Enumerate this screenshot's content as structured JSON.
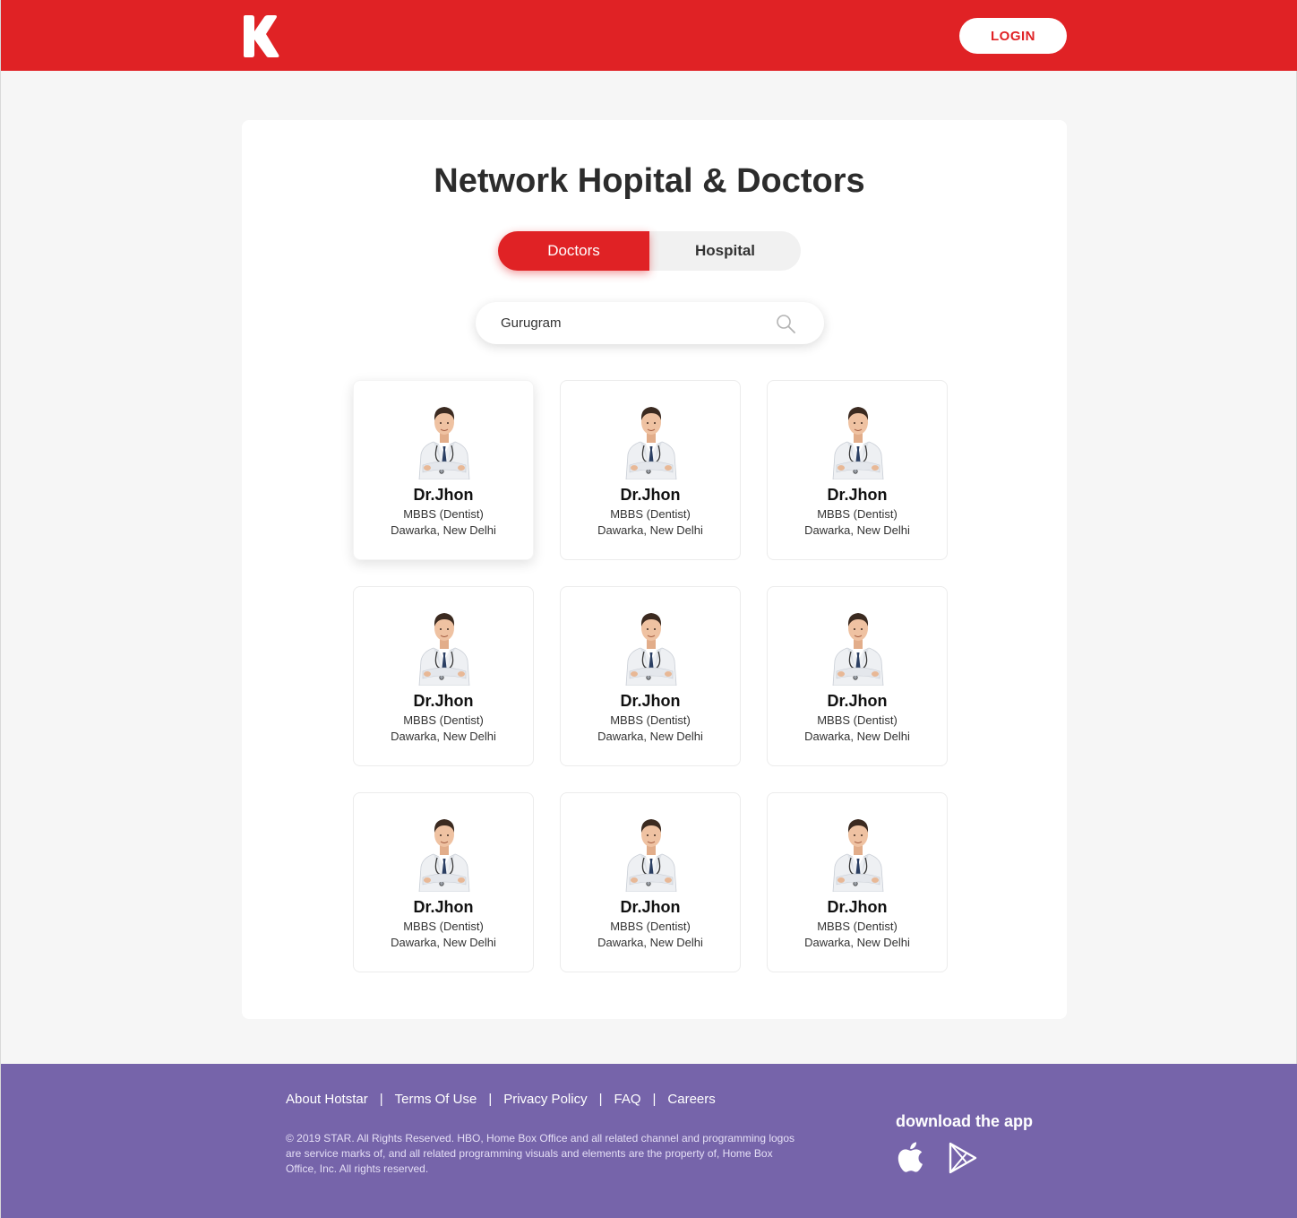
{
  "header": {
    "logo_letter": "K",
    "login_label": "LOGIN",
    "brand_color": "#e02225"
  },
  "main": {
    "title": "Network Hopital & Doctors",
    "tabs": [
      {
        "label": "Doctors",
        "active": true
      },
      {
        "label": "Hospital",
        "active": false
      }
    ],
    "search": {
      "value": "Gurugram",
      "icon": "search-icon"
    },
    "doctors": [
      {
        "name": "Dr.Jhon",
        "degree": "MBBS (Dentist)",
        "location": "Dawarka, New Delhi"
      },
      {
        "name": "Dr.Jhon",
        "degree": "MBBS (Dentist)",
        "location": "Dawarka, New Delhi"
      },
      {
        "name": "Dr.Jhon",
        "degree": "MBBS (Dentist)",
        "location": "Dawarka, New Delhi"
      },
      {
        "name": "Dr.Jhon",
        "degree": "MBBS (Dentist)",
        "location": "Dawarka, New Delhi"
      },
      {
        "name": "Dr.Jhon",
        "degree": "MBBS (Dentist)",
        "location": "Dawarka, New Delhi"
      },
      {
        "name": "Dr.Jhon",
        "degree": "MBBS (Dentist)",
        "location": "Dawarka, New Delhi"
      },
      {
        "name": "Dr.Jhon",
        "degree": "MBBS (Dentist)",
        "location": "Dawarka, New Delhi"
      },
      {
        "name": "Dr.Jhon",
        "degree": "MBBS (Dentist)",
        "location": "Dawarka, New Delhi"
      },
      {
        "name": "Dr.Jhon",
        "degree": "MBBS (Dentist)",
        "location": "Dawarka, New Delhi"
      }
    ]
  },
  "footer": {
    "links": [
      "About Hotstar",
      "Terms Of Use",
      "Privacy Policy",
      "FAQ",
      "Careers"
    ],
    "separator": "|",
    "copyright": "© 2019 STAR. All Rights Reserved. HBO, Home Box Office and all related channel and programming logos are service marks of, and all related programming visuals and elements are the property of, Home Box Office, Inc. All rights reserved.",
    "download_title": "download the app",
    "app_icons": [
      "apple-icon",
      "google-play-icon"
    ],
    "background_color": "#7664aa"
  }
}
